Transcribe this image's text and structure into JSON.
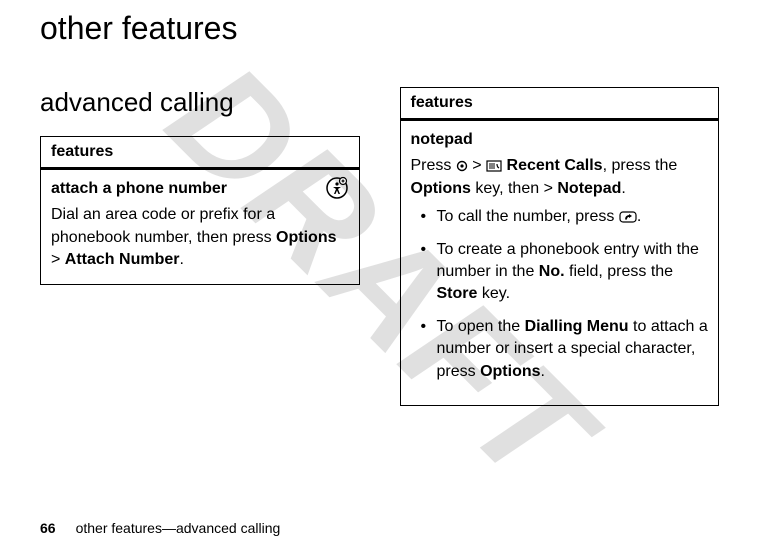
{
  "watermark": "DRAFT",
  "page_title": "other features",
  "footer": {
    "page_number": "66",
    "label": "other features—advanced calling"
  },
  "left": {
    "heading": "advanced calling",
    "box": {
      "header": "features",
      "sub": "attach a phone number",
      "body_pre": "Dial an area code or prefix for a phonebook number, then press ",
      "options": "Options",
      "gt": " > ",
      "attach": "Attach Number",
      "body_post": "."
    }
  },
  "right": {
    "box": {
      "header": "features",
      "sub": "notepad",
      "line1_a": "Press ",
      "line1_b": " > ",
      "recent": "Recent Calls",
      "line1_c": ", press the ",
      "options": "Options",
      "line1_d": " key, then > ",
      "notepad": "Notepad",
      "line1_e": ".",
      "bullet1_a": "To call the number, press ",
      "bullet1_b": ".",
      "bullet2_a": "To create a phonebook entry with the number in the ",
      "no": "No.",
      "bullet2_b": " field, press the ",
      "store": "Store",
      "bullet2_c": " key.",
      "bullet3_a": "To open the ",
      "dialling": "Dialling Menu",
      "bullet3_b": " to attach a number or insert a special character, press ",
      "options2": "Options",
      "bullet3_c": "."
    }
  },
  "icons": {
    "accessibility": "accessibility-icon",
    "center_key": "center-key-icon",
    "recent_calls": "recent-calls-icon",
    "send_key": "send-key-icon"
  }
}
